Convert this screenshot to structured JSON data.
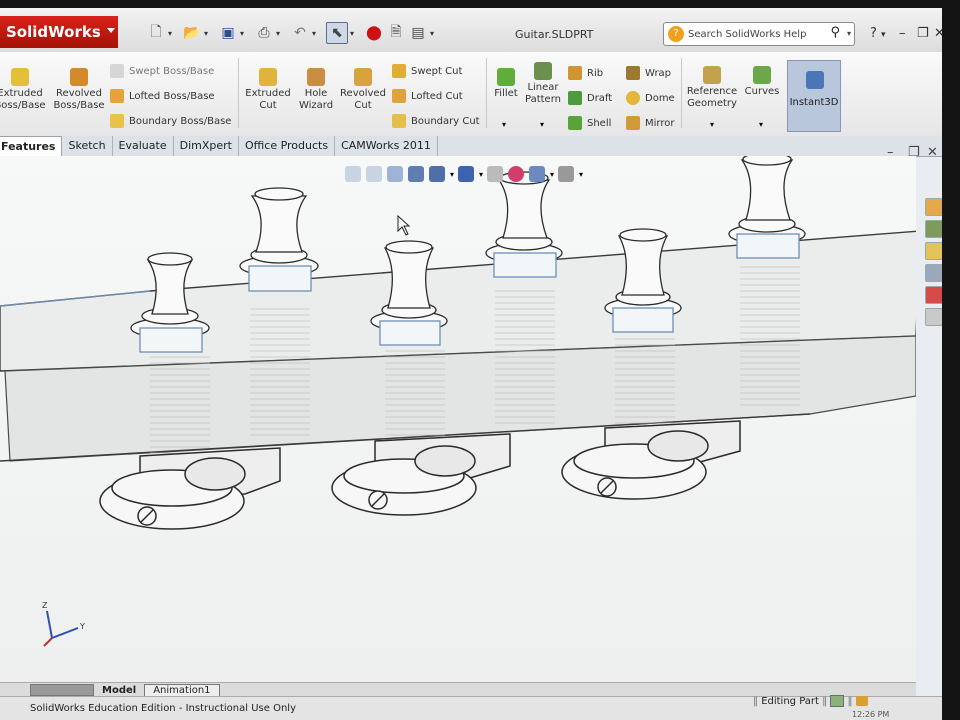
{
  "app": {
    "name": "SolidWorks",
    "document_title": "Guitar.SLDPRT",
    "help_search_placeholder": "Search SolidWorks Help"
  },
  "ribbon": {
    "features_left": [
      {
        "label": "Extruded\nBoss/Base",
        "icon": "extruded-boss-icon"
      },
      {
        "label": "Revolved\nBoss/Base",
        "icon": "revolved-boss-icon"
      }
    ],
    "boss_rows": [
      "Swept Boss/Base",
      "Lofted Boss/Base",
      "Boundary Boss/Base"
    ],
    "cut_buttons": [
      {
        "label": "Extruded\nCut",
        "icon": "extruded-cut-icon"
      },
      {
        "label": "Hole\nWizard",
        "icon": "hole-wizard-icon"
      },
      {
        "label": "Revolved\nCut",
        "icon": "revolved-cut-icon"
      }
    ],
    "cut_rows": [
      "Swept Cut",
      "Lofted Cut",
      "Boundary Cut"
    ],
    "fillet_label": "Fillet",
    "linear_pattern_label": "Linear\nPattern",
    "feature_col1": [
      "Rib",
      "Draft",
      "Shell"
    ],
    "feature_col2": [
      "Wrap",
      "Dome",
      "Mirror"
    ],
    "reference_geometry_label": "Reference\nGeometry",
    "curves_label": "Curves",
    "instant3d_label": "Instant3D"
  },
  "tabs": [
    "Features",
    "Sketch",
    "Evaluate",
    "DimXpert",
    "Office Products",
    "CAMWorks 2011"
  ],
  "active_tab": "Features",
  "model_tabs": [
    "Model",
    "Animation1"
  ],
  "status": {
    "left": "SolidWorks Education Edition - Instructional Use Only",
    "mode": "Editing Part",
    "time": "12:26 PM"
  },
  "colors": {
    "brand_red": "#c8190f",
    "ribbon_bg": "#f2f2f2",
    "viewport_bg": "#f3f4f4",
    "instant3d_active": "#b9c7dc"
  }
}
